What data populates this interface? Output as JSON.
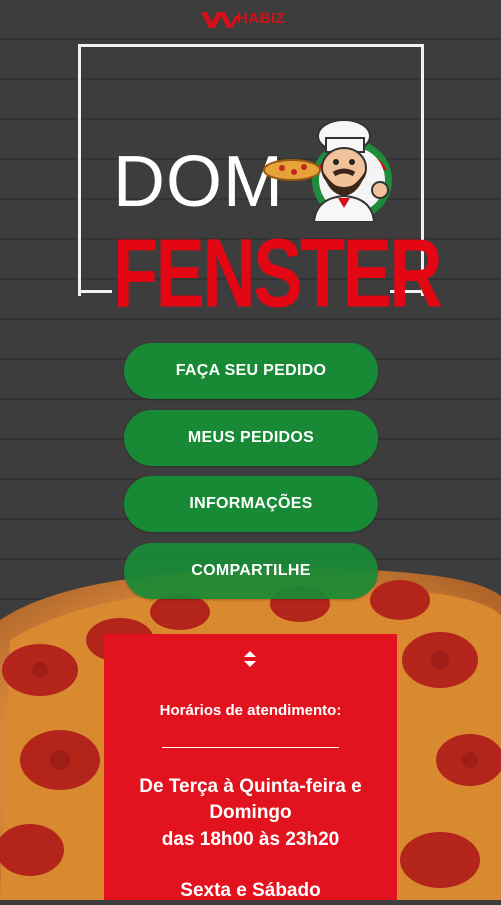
{
  "brand": {
    "top_logo_text": "HABIZ",
    "restaurant_name_line1": "DOM",
    "restaurant_name_line2": "FENSTER"
  },
  "colors": {
    "green_button": "#188a35",
    "red_panel": "#e2131e",
    "logo_red": "#e30613"
  },
  "menu": [
    {
      "label": "FAÇA SEU PEDIDO"
    },
    {
      "label": "MEUS PEDIDOS"
    },
    {
      "label": "INFORMAÇÕES"
    },
    {
      "label": "COMPARTILHE"
    }
  ],
  "hours": {
    "toggle_icon": "sort-arrows-icon",
    "title": "Horários de atendimento:",
    "line1": "De Terça à Quinta-feira e",
    "line2": "Domingo",
    "line3": "das 18h00 às 23h20",
    "line4": "Sexta e Sábado"
  }
}
